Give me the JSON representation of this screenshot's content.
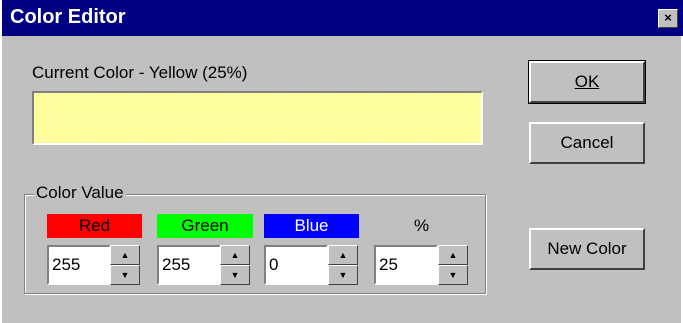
{
  "window": {
    "title": "Color Editor",
    "close_label": "×"
  },
  "current_color_label": "Current Color - Yellow (25%)",
  "swatch_color": "#ffff99",
  "buttons": {
    "ok": "OK",
    "cancel": "Cancel",
    "new_color": "New Color"
  },
  "group": {
    "title": "Color Value",
    "channels": [
      {
        "label": "Red",
        "value": "255",
        "color": "#ff0000"
      },
      {
        "label": "Green",
        "value": "255",
        "color": "#00ff00"
      },
      {
        "label": "Blue",
        "value": "0",
        "color": "#0000ff"
      },
      {
        "label": "%",
        "value": "25",
        "color": "#c0c0c0"
      }
    ]
  },
  "spinner": {
    "up": "▲",
    "down": "▼"
  }
}
